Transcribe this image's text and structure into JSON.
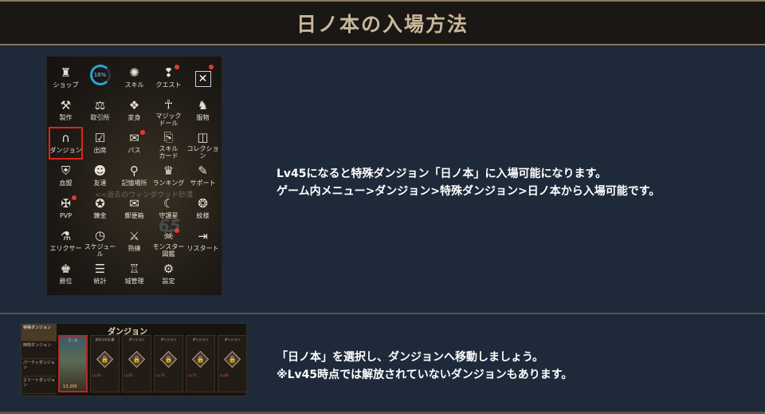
{
  "header": {
    "title": "日ノ本の入場方法"
  },
  "section1": {
    "menu": {
      "progress": "18%",
      "items": [
        {
          "label": "ショップ",
          "icon": "shop-bag-icon",
          "glyph": "♜"
        },
        {
          "label": "",
          "icon": "progress-ring-icon",
          "glyph": ""
        },
        {
          "label": "スキル",
          "icon": "skill-swirl-icon",
          "glyph": "✺"
        },
        {
          "label": "クエスト",
          "icon": "quest-scroll-icon",
          "glyph": "❢"
        },
        {
          "label": "",
          "icon": "close-icon",
          "glyph": "✕"
        },
        {
          "label": "製作",
          "icon": "anvil-icon",
          "glyph": "⚒"
        },
        {
          "label": "取引所",
          "icon": "scale-icon",
          "glyph": "⚖"
        },
        {
          "label": "変身",
          "icon": "transform-card-icon",
          "glyph": "❖"
        },
        {
          "label": "マジック\nドール",
          "icon": "magic-doll-icon",
          "glyph": "☥"
        },
        {
          "label": "服物",
          "icon": "boot-icon",
          "glyph": "♞"
        },
        {
          "label": "ダンジョン",
          "icon": "dungeon-gate-icon",
          "glyph": "∩"
        },
        {
          "label": "出席",
          "icon": "checkbox-icon",
          "glyph": "☑"
        },
        {
          "label": "パス",
          "icon": "ticket-icon",
          "glyph": "✉"
        },
        {
          "label": "スキル\nカード",
          "icon": "skill-card-icon",
          "glyph": "⎘"
        },
        {
          "label": "コレクション",
          "icon": "collection-icon",
          "glyph": "◫"
        },
        {
          "label": "血盟",
          "icon": "clan-shield-icon",
          "glyph": "⛨"
        },
        {
          "label": "友達",
          "icon": "friends-icon",
          "glyph": "☻"
        },
        {
          "label": "記憶場所",
          "icon": "map-pin-icon",
          "glyph": "⚲"
        },
        {
          "label": "ランキング",
          "icon": "trophy-icon",
          "glyph": "♛"
        },
        {
          "label": "サポート",
          "icon": "chat-bubble-icon",
          "glyph": "✎"
        },
        {
          "label": "PVP",
          "icon": "pvp-icon",
          "glyph": "✠"
        },
        {
          "label": "錬金",
          "icon": "alchemy-star-icon",
          "glyph": "✪"
        },
        {
          "label": "郵便箱",
          "icon": "mail-icon",
          "glyph": "✉"
        },
        {
          "label": "守護星",
          "icon": "guardian-star-icon",
          "glyph": "☾"
        },
        {
          "label": "紋様",
          "icon": "pattern-icon",
          "glyph": "❂"
        },
        {
          "label": "エリクサー",
          "icon": "elixir-icon",
          "glyph": "⚗"
        },
        {
          "label": "スケジュール",
          "icon": "schedule-icon",
          "glyph": "◷"
        },
        {
          "label": "熟練",
          "icon": "mastery-icon",
          "glyph": "⚔"
        },
        {
          "label": "モンスター\n図鑑",
          "icon": "monster-book-icon",
          "glyph": "☠"
        },
        {
          "label": "リスタート",
          "icon": "exit-icon",
          "glyph": "⇥"
        },
        {
          "label": "爵位",
          "icon": "rank-icon",
          "glyph": "♚"
        },
        {
          "label": "統計",
          "icon": "stats-book-icon",
          "glyph": "☰"
        },
        {
          "label": "城管理",
          "icon": "castle-icon",
          "glyph": "♖"
        },
        {
          "label": "設定",
          "icon": "gear-icon",
          "glyph": "⚙"
        }
      ],
      "background_text": "<<過去のウィンダウッド砂漠",
      "background_number": "65"
    },
    "description": {
      "line1": "Lv45になると特殊ダンジョン「日ノ本」に入場可能になります。",
      "line2": "ゲーム内メニュー>ダンジョン>特殊ダンジョン>日ノ本から入場可能です。"
    }
  },
  "section2": {
    "dungeon_window": {
      "title": "ダンジョン",
      "sidebar": [
        "特殊ダンジョン",
        "時間ダンジョン",
        "パーティダンジョン",
        "エリートダンジョン"
      ],
      "cards": [
        {
          "name": "日ノ本",
          "selected": true,
          "level": "",
          "count": "13,200"
        },
        {
          "name": "忘れられた島",
          "selected": false,
          "level": "Lv.60",
          "count": ""
        },
        {
          "name": "ダンジョン",
          "selected": false,
          "level": "Lv.65",
          "count": ""
        },
        {
          "name": "ダンジョン",
          "selected": false,
          "level": "Lv.70",
          "count": ""
        },
        {
          "name": "ダンジョン",
          "selected": false,
          "level": "Lv.75",
          "count": ""
        },
        {
          "name": "ダンジョン",
          "selected": false,
          "level": "Lv.80",
          "count": ""
        }
      ]
    },
    "description": {
      "line1": "「日ノ本」を選択し、ダンジョンへ移動しましょう。",
      "line2": "※Lv45時点では解放されていないダンジョンもあります。"
    }
  },
  "colors": {
    "background": "#1e2a3a",
    "header_bg": "#1a1714",
    "header_text": "#c8b89a",
    "highlight": "#e0231c",
    "notification": "#e53a2f"
  }
}
